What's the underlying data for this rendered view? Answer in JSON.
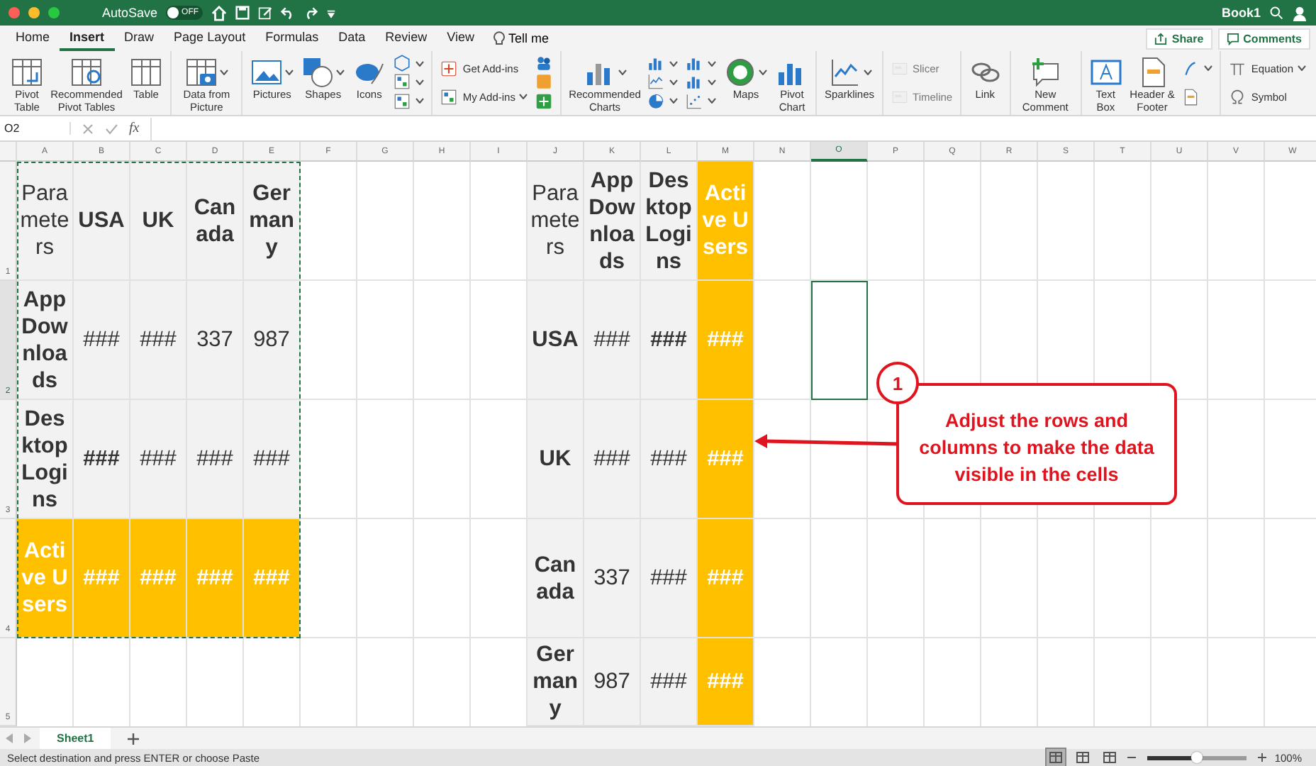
{
  "title_bar": {
    "autosave_label": "AutoSave",
    "autosave": {
      "on": false,
      "label": "OFF"
    },
    "document_title": "Book1"
  },
  "tabs": [
    {
      "label": "Home",
      "selected": false
    },
    {
      "label": "Insert",
      "selected": true
    },
    {
      "label": "Draw",
      "selected": false
    },
    {
      "label": "Page Layout",
      "selected": false
    },
    {
      "label": "Formulas",
      "selected": false
    },
    {
      "label": "Data",
      "selected": false
    },
    {
      "label": "Review",
      "selected": false
    },
    {
      "label": "View",
      "selected": false
    }
  ],
  "tell_me": "Tell me",
  "actions": [
    "Share",
    "Comments"
  ],
  "ribbon": [
    {
      "items": [
        {
          "kind": "large",
          "label": "Pivot Table",
          "dropdown": false,
          "disabled": false
        },
        {
          "kind": "large",
          "label": "Recommended Pivot Tables",
          "dropdown": false,
          "disabled": false
        },
        {
          "kind": "large",
          "label": "Table",
          "dropdown": false,
          "disabled": false
        }
      ]
    },
    {
      "items": [
        {
          "kind": "large",
          "label": "Data from Picture",
          "dropdown": true,
          "disabled": false
        }
      ]
    },
    {
      "items": [
        {
          "kind": "large",
          "label": "Pictures",
          "dropdown": true,
          "disabled": false
        },
        {
          "kind": "large",
          "label": "Shapes",
          "dropdown": true,
          "disabled": false
        },
        {
          "kind": "large",
          "label": "Icons",
          "dropdown": false,
          "disabled": false
        },
        {
          "kind": "stack",
          "items": [
            {
              "kind": "small",
              "dropdown": true,
              "disabled": false
            },
            {
              "kind": "small",
              "dropdown": true,
              "disabled": false
            },
            {
              "kind": "small",
              "dropdown": true,
              "disabled": false
            }
          ]
        }
      ]
    },
    {
      "items": [
        {
          "kind": "stack",
          "items": [
            {
              "kind": "small",
              "label": "Get Add-ins",
              "dropdown": false,
              "disabled": false
            },
            {
              "kind": "small",
              "label": "My Add-ins",
              "dropdown": true,
              "disabled": false
            }
          ]
        },
        {
          "kind": "stack",
          "items": [
            {
              "kind": "small",
              "dropdown": false,
              "disabled": false
            },
            {
              "kind": "small",
              "dropdown": false,
              "disabled": false
            },
            {
              "kind": "small",
              "dropdown": false,
              "disabled": false
            }
          ]
        }
      ]
    },
    {
      "items": [
        {
          "kind": "large",
          "label": "Recommended Charts",
          "dropdown": true,
          "disabled": false
        },
        {
          "kind": "stack",
          "items": [
            {
              "kind": "small",
              "dropdown": true,
              "disabled": false
            },
            {
              "kind": "small",
              "dropdown": true,
              "disabled": false
            },
            {
              "kind": "small",
              "dropdown": true,
              "disabled": false
            }
          ]
        },
        {
          "kind": "stack",
          "items": [
            {
              "kind": "small",
              "dropdown": true,
              "disabled": false
            },
            {
              "kind": "small",
              "dropdown": true,
              "disabled": false
            },
            {
              "kind": "small",
              "dropdown": true,
              "disabled": false
            }
          ]
        },
        {
          "kind": "large",
          "label": "Maps",
          "dropdown": true,
          "disabled": false
        },
        {
          "kind": "large",
          "label": "Pivot Chart",
          "dropdown": false,
          "disabled": false
        }
      ]
    },
    {
      "items": [
        {
          "kind": "large",
          "label": "Sparklines",
          "dropdown": true,
          "disabled": false
        }
      ]
    },
    {
      "items": [
        {
          "kind": "stack",
          "items": [
            {
              "kind": "small",
              "label": "Slicer",
              "dropdown": false,
              "disabled": true
            },
            {
              "kind": "small",
              "label": "Timeline",
              "dropdown": false,
              "disabled": true
            }
          ]
        }
      ]
    },
    {
      "items": [
        {
          "kind": "large",
          "label": "Link",
          "dropdown": false,
          "disabled": false
        }
      ]
    },
    {
      "items": [
        {
          "kind": "large",
          "label": "New Comment",
          "dropdown": false,
          "disabled": false
        }
      ]
    },
    {
      "items": [
        {
          "kind": "large",
          "label": "Text Box",
          "dropdown": false,
          "disabled": false
        },
        {
          "kind": "large",
          "label": "Header & Footer",
          "dropdown": false,
          "disabled": false
        },
        {
          "kind": "stack",
          "items": [
            {
              "kind": "small",
              "dropdown": true,
              "disabled": false
            },
            {
              "kind": "small",
              "dropdown": false,
              "disabled": false
            }
          ]
        }
      ]
    },
    {
      "items": [
        {
          "kind": "stack",
          "items": [
            {
              "kind": "small",
              "label": "Equation",
              "dropdown": true,
              "disabled": false
            },
            {
              "kind": "small",
              "label": "Symbol",
              "dropdown": false,
              "disabled": false
            }
          ]
        }
      ]
    }
  ],
  "formula_bar": {
    "name_box": "O2",
    "function_label": "fx"
  },
  "column_headers": [
    {
      "label": "A",
      "selected": false
    },
    {
      "label": "B",
      "selected": false
    },
    {
      "label": "C",
      "selected": false
    },
    {
      "label": "D",
      "selected": false
    },
    {
      "label": "E",
      "selected": false
    },
    {
      "label": "F",
      "selected": false
    },
    {
      "label": "G",
      "selected": false
    },
    {
      "label": "H",
      "selected": false
    },
    {
      "label": "I",
      "selected": false
    },
    {
      "label": "J",
      "selected": false
    },
    {
      "label": "K",
      "selected": false
    },
    {
      "label": "L",
      "selected": false
    },
    {
      "label": "M",
      "selected": false
    },
    {
      "label": "N",
      "selected": false
    },
    {
      "label": "O",
      "selected": true
    },
    {
      "label": "P",
      "selected": false
    },
    {
      "label": "Q",
      "selected": false
    },
    {
      "label": "R",
      "selected": false
    },
    {
      "label": "S",
      "selected": false
    },
    {
      "label": "T",
      "selected": false
    },
    {
      "label": "U",
      "selected": false
    },
    {
      "label": "V",
      "selected": false
    },
    {
      "label": "W",
      "selected": false
    }
  ],
  "row_headers": [
    {
      "label": "1",
      "selected": false
    },
    {
      "label": "2",
      "selected": true
    },
    {
      "label": "3",
      "selected": false
    },
    {
      "label": "4",
      "selected": false
    },
    {
      "label": "5",
      "selected": false
    }
  ],
  "left_table": {
    "marquee": true,
    "rows": [
      [
        {
          "text": "Parameters",
          "bold": false,
          "highlight": false
        },
        {
          "text": "USA",
          "bold": true,
          "highlight": false
        },
        {
          "text": "UK",
          "bold": true,
          "highlight": false
        },
        {
          "text": "Canada",
          "bold": true,
          "highlight": false
        },
        {
          "text": "Germany",
          "bold": true,
          "highlight": false
        }
      ],
      [
        {
          "text": "App Downloads",
          "bold": true,
          "highlight": false
        },
        {
          "text": "###",
          "bold": false,
          "highlight": false
        },
        {
          "text": "###",
          "bold": false,
          "highlight": false
        },
        {
          "text": "337",
          "bold": false,
          "highlight": false
        },
        {
          "text": "987",
          "bold": false,
          "highlight": false
        }
      ],
      [
        {
          "text": "Desktop Logins",
          "bold": true,
          "highlight": false
        },
        {
          "text": "###",
          "bold": true,
          "highlight": false
        },
        {
          "text": "###",
          "bold": false,
          "highlight": false
        },
        {
          "text": "###",
          "bold": false,
          "highlight": false
        },
        {
          "text": "###",
          "bold": false,
          "highlight": false
        }
      ],
      [
        {
          "text": "Active Users",
          "bold": true,
          "highlight": true
        },
        {
          "text": "###",
          "bold": true,
          "highlight": true
        },
        {
          "text": "###",
          "bold": true,
          "highlight": true
        },
        {
          "text": "###",
          "bold": true,
          "highlight": true
        },
        {
          "text": "###",
          "bold": true,
          "highlight": true
        }
      ]
    ]
  },
  "right_table": {
    "rows": [
      [
        {
          "text": "Parameters",
          "bold": false,
          "highlight": false
        },
        {
          "text": "App Downloads",
          "bold": true,
          "highlight": false
        },
        {
          "text": "Desktop Logins",
          "bold": true,
          "highlight": false
        },
        {
          "text": "Active Users",
          "bold": true,
          "highlight": true
        }
      ],
      [
        {
          "text": "USA",
          "bold": true,
          "highlight": false
        },
        {
          "text": "###",
          "bold": false,
          "highlight": false
        },
        {
          "text": "###",
          "bold": true,
          "highlight": false
        },
        {
          "text": "###",
          "bold": true,
          "highlight": true
        }
      ],
      [
        {
          "text": "UK",
          "bold": true,
          "highlight": false
        },
        {
          "text": "###",
          "bold": false,
          "highlight": false
        },
        {
          "text": "###",
          "bold": false,
          "highlight": false
        },
        {
          "text": "###",
          "bold": true,
          "highlight": true
        }
      ],
      [
        {
          "text": "Canada",
          "bold": true,
          "highlight": false
        },
        {
          "text": "337",
          "bold": false,
          "highlight": false
        },
        {
          "text": "###",
          "bold": false,
          "highlight": false
        },
        {
          "text": "###",
          "bold": true,
          "highlight": true
        }
      ],
      [
        {
          "text": "Germany",
          "bold": true,
          "highlight": false
        },
        {
          "text": "987",
          "bold": false,
          "highlight": false
        },
        {
          "text": "###",
          "bold": false,
          "highlight": false
        },
        {
          "text": "###",
          "bold": true,
          "highlight": true
        }
      ]
    ]
  },
  "callout": {
    "number": "1",
    "text": "Adjust the rows and columns to make the data visible in the cells"
  },
  "sheets": [
    {
      "label": "Sheet1",
      "selected": true
    }
  ],
  "status_bar": {
    "message": "Select destination and press ENTER or choose Paste",
    "views": [
      {
        "selected": true
      },
      {
        "selected": false
      },
      {
        "selected": false
      }
    ],
    "zoom": {
      "level": 0.5,
      "label": "100%"
    }
  }
}
